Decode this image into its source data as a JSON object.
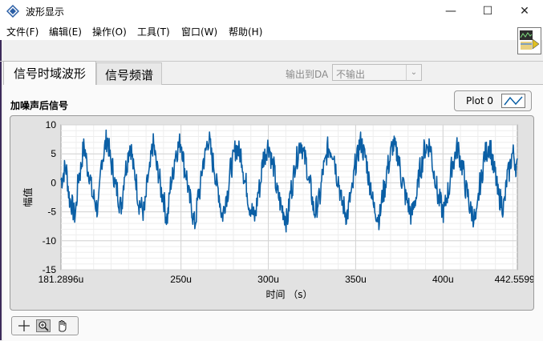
{
  "window": {
    "title": "波形显示",
    "minimize": "—",
    "maximize": "☐",
    "close": "✕"
  },
  "menu": [
    "文件(F)",
    "编辑(E)",
    "操作(O)",
    "工具(T)",
    "窗口(W)",
    "帮助(H)"
  ],
  "tabs": [
    {
      "label": "信号时域波形",
      "active": true
    },
    {
      "label": "信号频谱",
      "active": false
    }
  ],
  "da_output": {
    "label": "输出到DA",
    "value": "不输出"
  },
  "graph": {
    "label": "加噪声后信号",
    "legend": "Plot 0",
    "line_color": "#0b5fa5"
  },
  "chart_data": {
    "type": "line",
    "title": "",
    "xlabel": "时间 （s）",
    "ylabel": "幅值",
    "xlim": [
      181.2896,
      442.5599
    ],
    "ylim": [
      -15,
      10
    ],
    "x_ticks": [
      "181.2896u",
      "250u",
      "300u",
      "350u",
      "400u",
      "442.5599u"
    ],
    "y_ticks": [
      "10",
      "5",
      "0",
      "-5",
      "-10",
      "-15"
    ],
    "grid": true,
    "series": [
      {
        "name": "Plot 0",
        "x_start": 181.2896,
        "x_end": 442.5599,
        "y": [
          0.5,
          2.5,
          -3,
          -5.5,
          1.5,
          6,
          2,
          -2.5,
          -4.5,
          4.5,
          7.5,
          3,
          -1,
          -4,
          2.5,
          6.5,
          1.5,
          -3.5,
          -5,
          1,
          6.5,
          2,
          -2,
          -6,
          0.5,
          5.5,
          7,
          2,
          -3,
          -7,
          -1.5,
          4,
          7.5,
          3.5,
          -1,
          -5.5,
          -2,
          3,
          6,
          5,
          0,
          -4,
          -6,
          -1,
          4.5,
          6.5,
          3,
          -2,
          -4.5,
          -6.5,
          -1,
          4,
          7,
          4,
          -0.5,
          -5,
          -3,
          2.5,
          6,
          5.5,
          1,
          -3.5,
          -5.5,
          -2,
          3.5,
          7,
          4.5,
          0,
          -4.5,
          -6,
          -1.5,
          3,
          6.5,
          5,
          0.5,
          -3,
          -5.5,
          -2.5,
          2.5,
          6,
          6.5,
          1.5,
          -3,
          -5,
          -1.5,
          3.5,
          6,
          3,
          -1.5,
          -5,
          -6.5,
          0,
          5,
          6.5,
          2,
          -2.5,
          -4,
          1.5,
          5,
          2.5
        ]
      }
    ]
  },
  "palette": {
    "tools": [
      "crosshair-tool",
      "zoom-tool",
      "pan-tool"
    ]
  }
}
